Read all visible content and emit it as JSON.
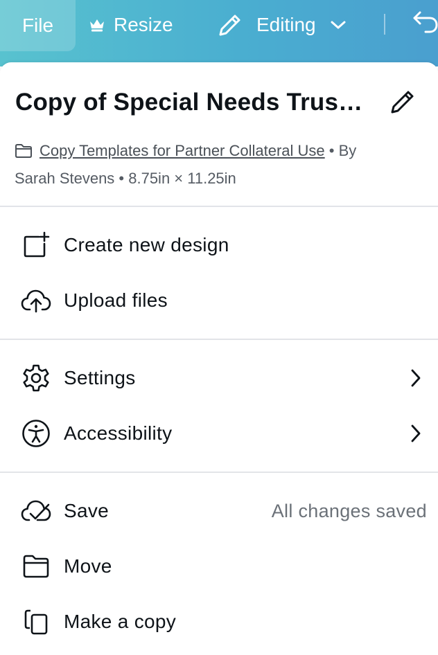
{
  "toolbar": {
    "file_label": "File",
    "resize_label": "Resize",
    "editing_label": "Editing",
    "crown_icon": "crown-icon",
    "pencil_icon": "pencil-icon",
    "undo_icon": "undo-icon",
    "gradient_colors": [
      "#58c2cf",
      "#4a9fcf"
    ]
  },
  "design": {
    "title": "Copy of Special Needs Trus…",
    "folder_link": "Copy Templates for Partner Collateral Use",
    "by_text": " • By",
    "author_dims": "Sarah Stevens • 8.75in × 11.25in"
  },
  "menu": {
    "create": {
      "label": "Create new design",
      "icon": "add-page-icon"
    },
    "upload": {
      "label": "Upload files",
      "icon": "cloud-upload-icon"
    },
    "settings": {
      "label": "Settings",
      "icon": "gear-icon"
    },
    "accessibility": {
      "label": "Accessibility",
      "icon": "accessibility-icon"
    },
    "save": {
      "label": "Save",
      "status": "All changes saved",
      "icon": "cloud-check-icon"
    },
    "move": {
      "label": "Move",
      "icon": "folder-icon"
    },
    "copy": {
      "label": "Make a copy",
      "icon": "copy-icon"
    }
  }
}
